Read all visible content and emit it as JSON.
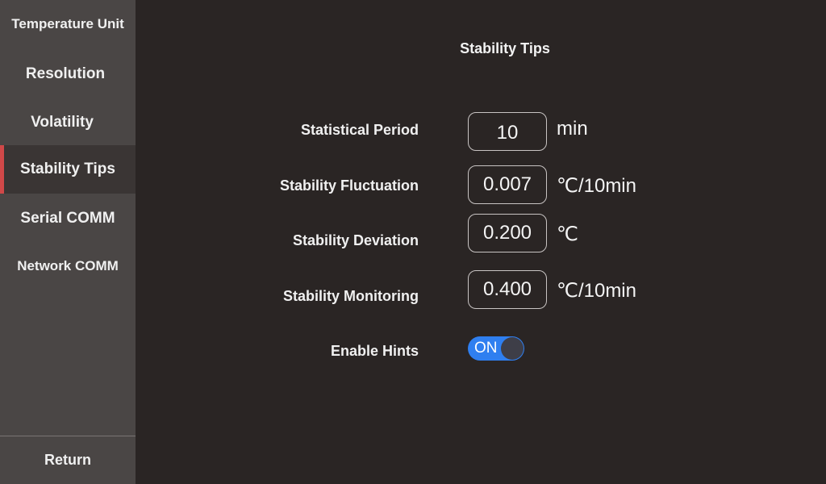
{
  "sidebar": {
    "items": [
      {
        "label": "Temperature Unit",
        "active": false
      },
      {
        "label": "Resolution",
        "active": false
      },
      {
        "label": "Volatility",
        "active": false
      },
      {
        "label": "Stability Tips",
        "active": true
      },
      {
        "label": "Serial COMM",
        "active": false
      },
      {
        "label": "Network COMM",
        "active": false
      }
    ],
    "return_label": "Return"
  },
  "main": {
    "title": "Stability Tips",
    "fields": [
      {
        "label": "Statistical Period",
        "value": "10",
        "unit": "min"
      },
      {
        "label": "Stability Fluctuation",
        "value": "0.007",
        "unit": "℃/10min"
      },
      {
        "label": "Stability Deviation",
        "value": "0.200",
        "unit": "℃"
      },
      {
        "label": "Stability Monitoring",
        "value": "0.400",
        "unit": "℃/10min"
      }
    ],
    "enable_hints": {
      "label": "Enable Hints",
      "state": "ON"
    }
  },
  "colors": {
    "accent_red": "#d04848",
    "toggle_blue": "#2f7ff0",
    "sidebar_bg": "#4a4645",
    "main_bg": "#2a2524"
  }
}
